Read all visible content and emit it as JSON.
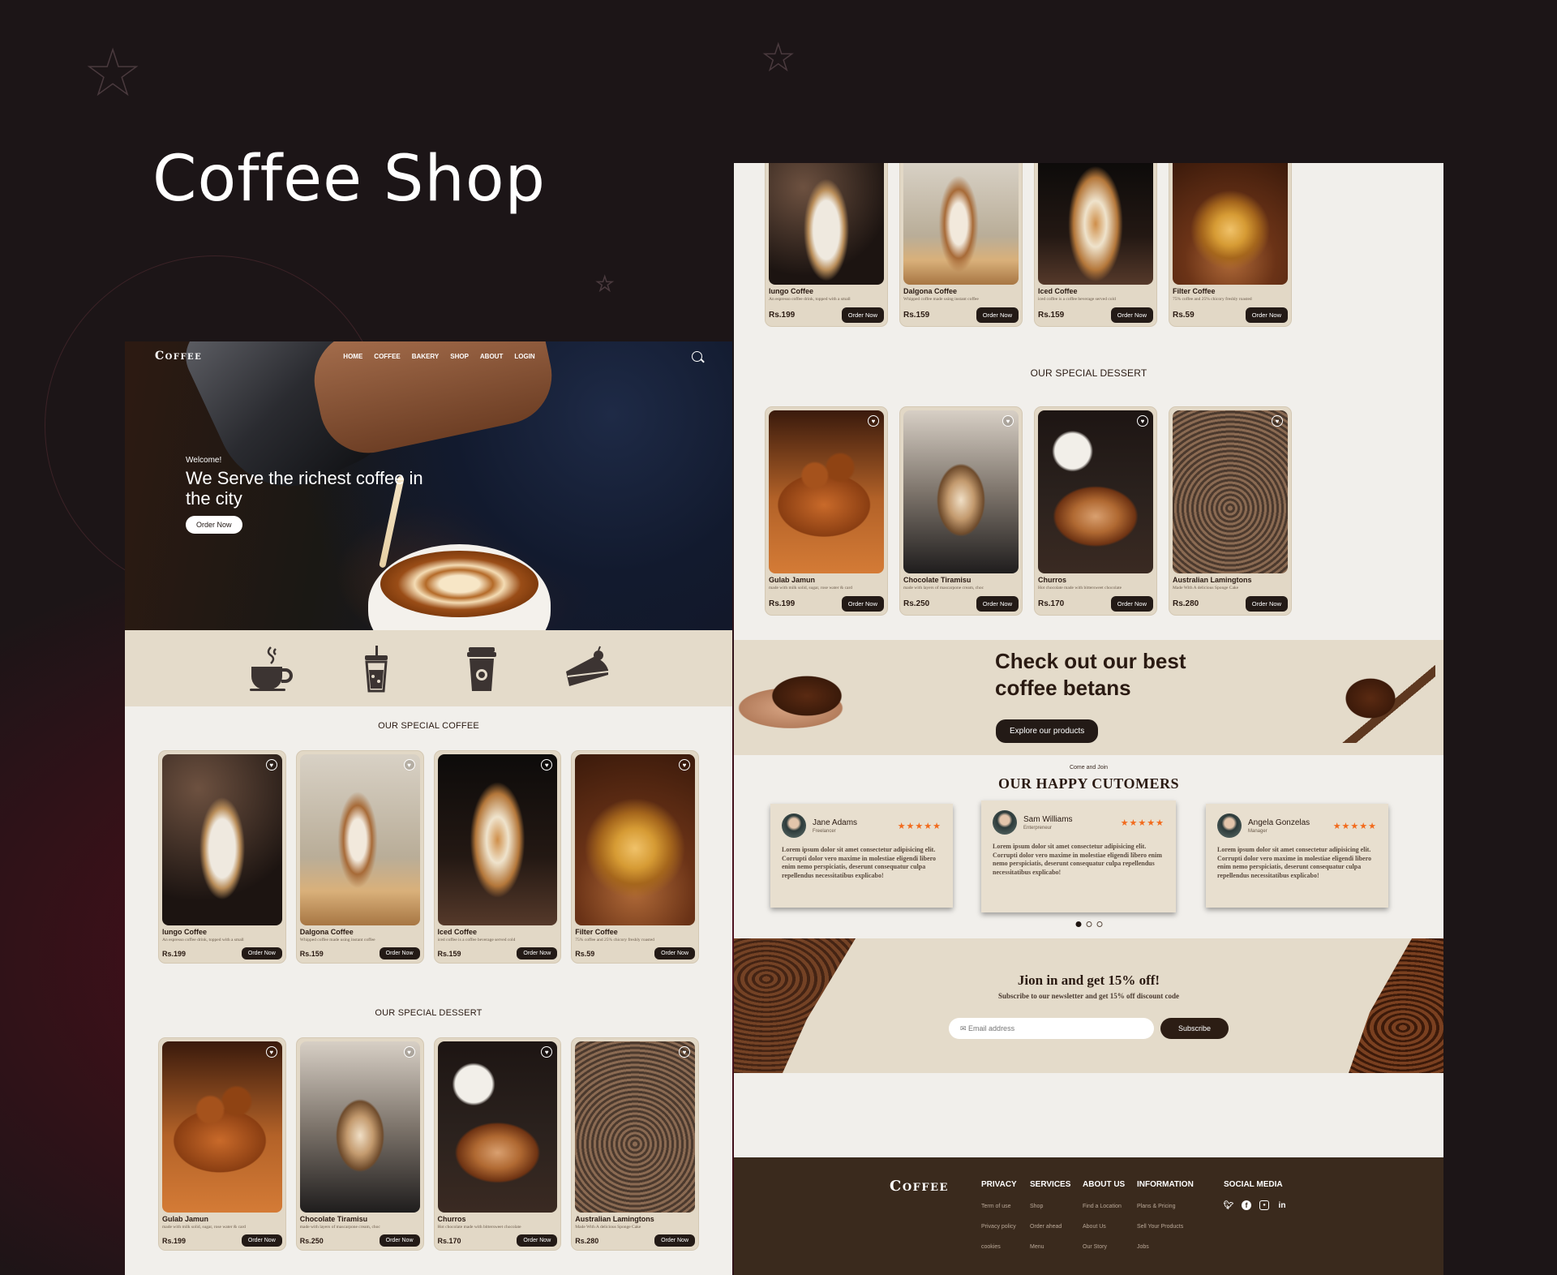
{
  "showcase": {
    "title": "Coffee Shop"
  },
  "brand": "Coffee",
  "nav": [
    "HOME",
    "COFFEE",
    "BAKERY",
    "SHOP",
    "ABOUT",
    "LOGIN"
  ],
  "hero": {
    "welcome": "Welcome!",
    "headline": "We Serve the richest coffee in the city",
    "button": "Order Now"
  },
  "category_icons": [
    "coffee-cup-icon",
    "iced-drink-icon",
    "takeaway-cup-icon",
    "cake-slice-icon"
  ],
  "coffee_section": {
    "title": "OUR SPECIAL COFFEE",
    "items": [
      {
        "name": "lungo Coffee",
        "desc": "An espresso coffee drink, topped with a small",
        "price": "Rs.199",
        "button": "Order Now"
      },
      {
        "name": "Dalgona Coffee",
        "desc": "Whipped coffee made using instant coffee",
        "price": "Rs.159",
        "button": "Order Now"
      },
      {
        "name": "Iced Coffee",
        "desc": "iced coffee is a coffee beverage served cold",
        "price": "Rs.159",
        "button": "Order Now"
      },
      {
        "name": "Filter Coffee",
        "desc": "75% coffee and 25% chicory freshly roasted",
        "price": "Rs.59",
        "button": "Order Now"
      }
    ]
  },
  "dessert_section": {
    "title": "OUR SPECIAL DESSERT",
    "items": [
      {
        "name": "Gulab Jamun",
        "desc": "made with milk solid, sugar, rose water & card",
        "price": "Rs.199",
        "button": "Order Now"
      },
      {
        "name": "Chocolate Tiramisu",
        "desc": "made with layers of mascarpone cream, choc",
        "price": "Rs.250",
        "button": "Order Now"
      },
      {
        "name": "Churros",
        "desc": "Hot chocolate made with bittersweet chocolate",
        "price": "Rs.170",
        "button": "Order Now"
      },
      {
        "name": "Australian Lamingtons",
        "desc": "Made With A delicious Sponge Cake",
        "price": "Rs.280",
        "button": "Order Now"
      }
    ]
  },
  "banner": {
    "headline": "Check out our best coffee betans",
    "button": "Explore our products"
  },
  "testimonials": {
    "small": "Come and Join",
    "title": "OUR HAPPY CUTOMERS",
    "stars": "★★★★★",
    "items": [
      {
        "name": "Jane Adams",
        "role": "Freelancer",
        "text": "Lorem ipsum dolor sit amet consectetur adipisicing elit. Corrupti dolor vero maxime in molestiae eligendi libero enim nemo perspiciatis, deserunt consequatur culpa repellendus necessitatibus explicabo!"
      },
      {
        "name": "Sam Williams",
        "role": "Enterpreneur",
        "text": "Lorem ipsum dolor sit amet consectetur adipisicing elit. Corrupti dolor vero maxime in molestiae eligendi libero enim nemo perspiciatis, deserunt consequatur culpa repellendus necessitatibus explicabo!"
      },
      {
        "name": "Angela Gonzelas",
        "role": "Manager",
        "text": "Lorem ipsum dolor sit amet consectetur adipisicing elit. Corrupti dolor vero maxime in molestiae eligendi libero enim nemo perspiciatis, deserunt consequatur culpa repellendus necessitatibus explicabo!"
      }
    ]
  },
  "newsletter": {
    "title": "Jion in and get 15% off!",
    "subtitle": "Subscribe to our newsletter and get 15% off discount code",
    "placeholder": "✉ Email address",
    "button": "Subscribe"
  },
  "footer": {
    "columns": [
      {
        "heading": "PRIVACY",
        "links": [
          "Term of use",
          "Privacy policy",
          "cookies"
        ]
      },
      {
        "heading": "SERVICES",
        "links": [
          "Shop",
          "Order ahead",
          "Menu"
        ]
      },
      {
        "heading": "ABOUT US",
        "links": [
          "Find a Location",
          "About Us",
          "Our Story"
        ]
      },
      {
        "heading": "INFORMATION",
        "links": [
          "Plans & Pricing",
          "Sell Your Products",
          "Jobs"
        ]
      }
    ],
    "social_heading": "SOCIAL MEDIA",
    "social_icons": [
      "twitter-icon",
      "facebook-icon",
      "instagram-icon",
      "linkedin-icon"
    ]
  },
  "colors": {
    "dark_brown": "#231a16",
    "beige": "#e4dbca",
    "card": "#e2d8c6",
    "star_orange": "#f26b1d",
    "footer": "#3a2a1d"
  }
}
